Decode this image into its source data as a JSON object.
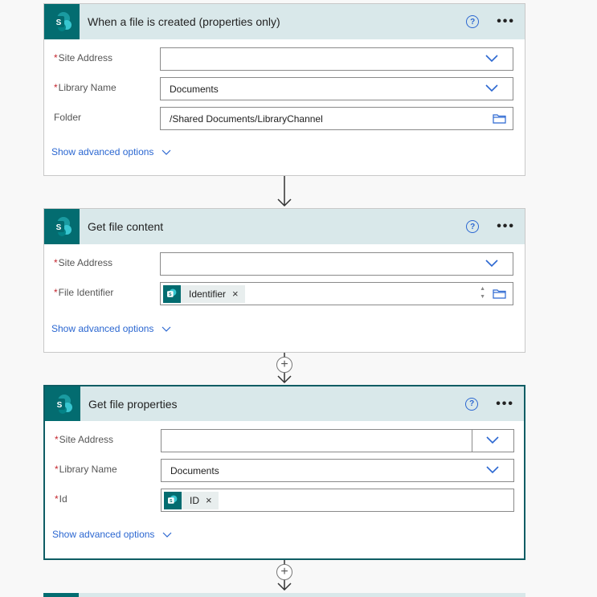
{
  "cards": [
    {
      "title": "When a file is created (properties only)",
      "help": "?",
      "more": "•••",
      "fields": [
        {
          "label": "Site Address",
          "required": "*",
          "value": ""
        },
        {
          "label": "Library Name",
          "required": "*",
          "value": "Documents"
        },
        {
          "label": "Folder",
          "value": "/Shared Documents/LibraryChannel"
        }
      ],
      "advanced": "Show advanced options"
    },
    {
      "title": "Get file content",
      "help": "?",
      "more": "•••",
      "fields": [
        {
          "label": "Site Address",
          "required": "*",
          "value": ""
        },
        {
          "label": "File Identifier",
          "required": "*",
          "token": "Identifier"
        }
      ],
      "advanced": "Show advanced options"
    },
    {
      "title": "Get file properties",
      "help": "?",
      "more": "•••",
      "fields": [
        {
          "label": "Site Address",
          "required": "*",
          "value": ""
        },
        {
          "label": "Library Name",
          "required": "*",
          "value": "Documents"
        },
        {
          "label": "Id",
          "required": "*",
          "token": "ID"
        }
      ],
      "advanced": "Show advanced options"
    }
  ],
  "token_remove": "×",
  "add_step": "+",
  "colors": {
    "brand": "#036c70",
    "header": "#d9e8ea",
    "link": "#2b67d1",
    "required": "#c4262e"
  },
  "icons": [
    "sharepoint-logo-icon",
    "help-icon",
    "more-icon",
    "chevron-down-icon",
    "folder-icon",
    "down-arrow-icon",
    "add-step-icon"
  ]
}
